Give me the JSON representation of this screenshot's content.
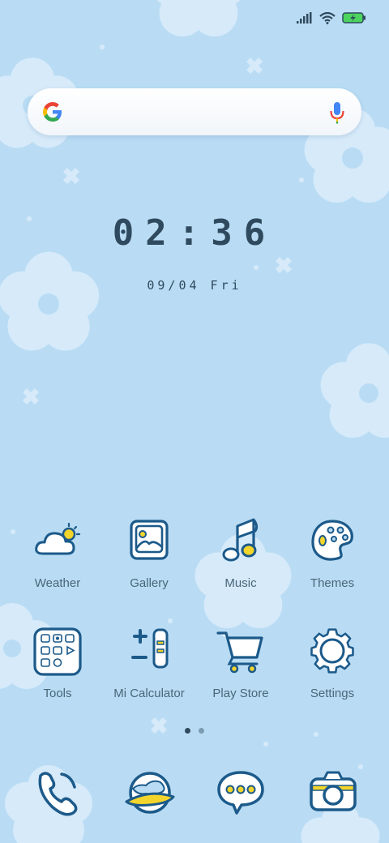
{
  "colors": {
    "background": "#b9dcf4",
    "flower": "#d8ecfa",
    "icon_stroke": "#1c5a8a",
    "icon_accent": "#f4d52c",
    "text": "#4a6678",
    "clock_text": "#2f4a5e"
  },
  "status_bar": {
    "icons": [
      "signal-icon",
      "wifi-icon",
      "battery-charging-icon"
    ]
  },
  "search": {
    "icons": [
      "google-logo-icon",
      "microphone-icon"
    ]
  },
  "clock": {
    "time": "02:36",
    "date": "09/04 Fri"
  },
  "apps": [
    {
      "label": "Weather",
      "icon": "weather-icon"
    },
    {
      "label": "Gallery",
      "icon": "gallery-icon"
    },
    {
      "label": "Music",
      "icon": "music-icon"
    },
    {
      "label": "Themes",
      "icon": "themes-icon"
    },
    {
      "label": "Tools",
      "icon": "tools-folder-icon"
    },
    {
      "label": "Mi Calculator",
      "icon": "calculator-icon"
    },
    {
      "label": "Play Store",
      "icon": "cart-icon"
    },
    {
      "label": "Settings",
      "icon": "gear-icon"
    }
  ],
  "page_indicator": {
    "pages": 2,
    "active": 1
  },
  "dock": {
    "icons": [
      "phone-icon",
      "browser-icon",
      "messages-icon",
      "camera-icon"
    ]
  }
}
